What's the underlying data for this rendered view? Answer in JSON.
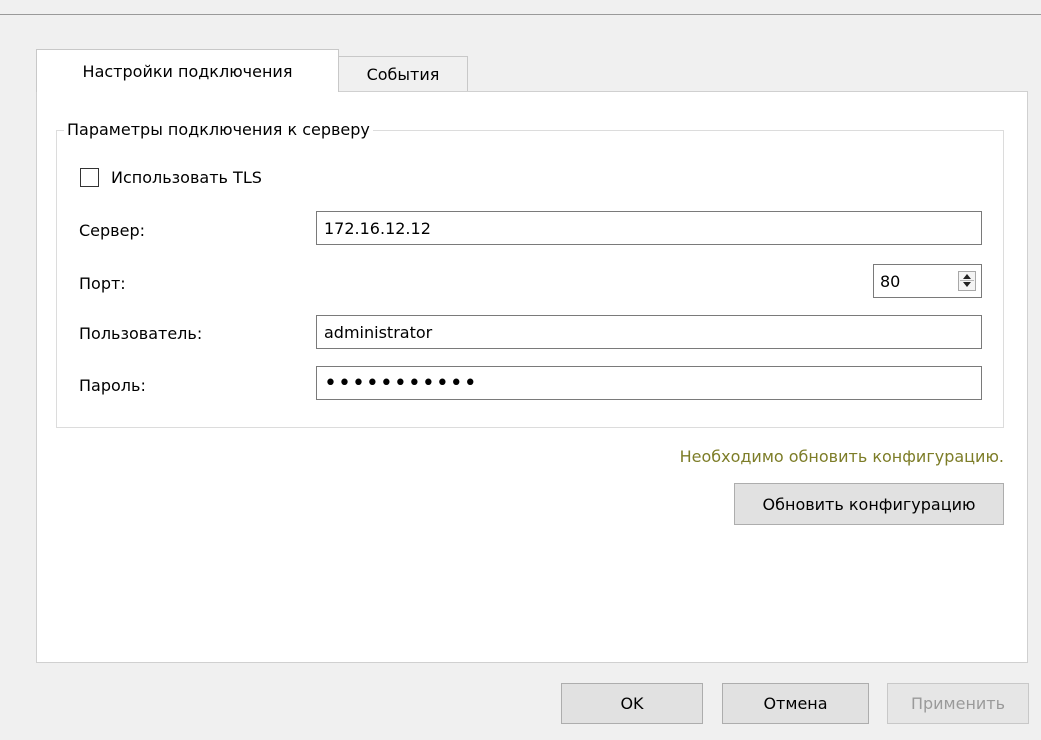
{
  "tabs": [
    {
      "label": "Настройки подключения",
      "active": true
    },
    {
      "label": "События",
      "active": false
    }
  ],
  "connection": {
    "group_title": "Параметры подключения к серверу",
    "tls_label": "Использовать TLS",
    "tls_checked": false,
    "server_label": "Сервер:",
    "server_value": "172.16.12.12",
    "port_label": "Порт:",
    "port_value": "80",
    "user_label": "Пользователь:",
    "user_value": "administrator",
    "password_label": "Пароль:",
    "password_value": "•••••••••••"
  },
  "config": {
    "notice": "Необходимо обновить конфигурацию.",
    "notice_color": "#7d7d28",
    "update_button": "Обновить конфигурацию"
  },
  "dialog_buttons": {
    "ok": "OK",
    "cancel": "Отмена",
    "apply": "Применить"
  }
}
